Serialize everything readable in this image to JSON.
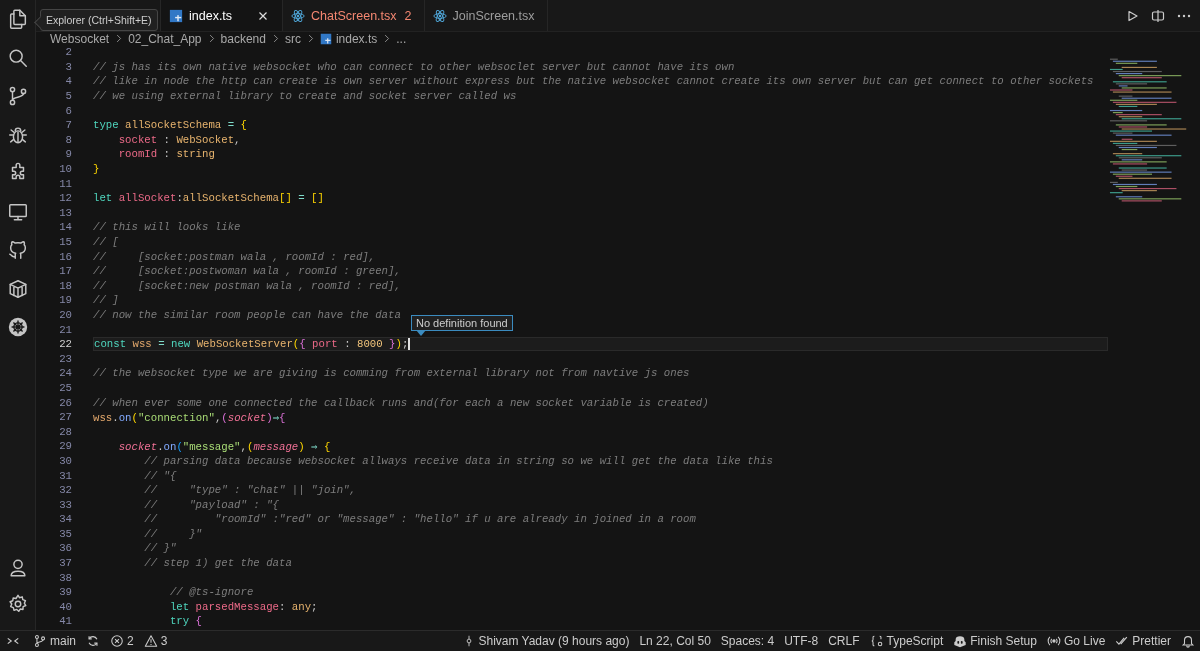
{
  "tooltip": {
    "text": "Explorer (Ctrl+Shift+E)"
  },
  "tabs": [
    {
      "label": "index.ts",
      "kind": "ts",
      "selected": true
    },
    {
      "label": "ChatScreen.tsx",
      "kind": "react",
      "selected": false,
      "problems": "2"
    },
    {
      "label": "JoinScreen.tsx",
      "kind": "react",
      "selected": false
    }
  ],
  "breadcrumbs": [
    {
      "label": "Websocket",
      "kind": "folder"
    },
    {
      "label": "02_Chat_App",
      "kind": "folder"
    },
    {
      "label": "backend",
      "kind": "folder"
    },
    {
      "label": "src",
      "kind": "folder"
    },
    {
      "label": "index.ts",
      "kind": "ts"
    },
    {
      "label": "...",
      "kind": "more"
    }
  ],
  "code": {
    "lines": [
      {
        "number": "2",
        "current": false
      },
      {
        "number": "3",
        "current": false,
        "tokens": [
          {
            "kind": "comment",
            "text": "// js has its own native websocket who can connect to other websoclet server but cannot have its own"
          }
        ]
      },
      {
        "number": "4",
        "current": false,
        "tokens": [
          {
            "kind": "comment",
            "text": "// like in node the http can create is own server without express but the native websocket cannot create its own server but can get connect to other sockets"
          }
        ]
      },
      {
        "number": "5",
        "current": false,
        "tokens": [
          {
            "kind": "comment",
            "text": "// we using external library to create and socket server called ws"
          }
        ]
      },
      {
        "number": "6",
        "current": false
      },
      {
        "number": "7",
        "current": false,
        "tokens": [
          {
            "kind": "keyword",
            "text": "type "
          },
          {
            "kind": "type",
            "text": "allSocketSchema"
          },
          {
            "kind": "operator",
            "text": " = "
          },
          {
            "kind": "bracket1",
            "text": "{"
          }
        ]
      },
      {
        "number": "8",
        "current": false,
        "tokens": [
          {
            "kind": "variable",
            "text": "    socket"
          },
          {
            "kind": "punct",
            "text": " : "
          },
          {
            "kind": "type",
            "text": "WebSocket"
          },
          {
            "kind": "punct",
            "text": ","
          }
        ]
      },
      {
        "number": "9",
        "current": false,
        "tokens": [
          {
            "kind": "variable",
            "text": "    roomId"
          },
          {
            "kind": "punct",
            "text": " : "
          },
          {
            "kind": "type",
            "text": "string"
          }
        ]
      },
      {
        "number": "10",
        "current": false,
        "tokens": [
          {
            "kind": "bracket1",
            "text": "}"
          }
        ]
      },
      {
        "number": "11",
        "current": false
      },
      {
        "number": "12",
        "current": false,
        "tokens": [
          {
            "kind": "keyword",
            "text": "let "
          },
          {
            "kind": "variable",
            "text": "allSocket"
          },
          {
            "kind": "punct",
            "text": ":"
          },
          {
            "kind": "type",
            "text": "allSocketSchema"
          },
          {
            "kind": "bracket1",
            "text": "[]"
          },
          {
            "kind": "operator",
            "text": " = "
          },
          {
            "kind": "bracket1",
            "text": "[]"
          }
        ]
      },
      {
        "number": "13",
        "current": false
      },
      {
        "number": "14",
        "current": false,
        "tokens": [
          {
            "kind": "comment",
            "text": "// this will looks like"
          }
        ]
      },
      {
        "number": "15",
        "current": false,
        "tokens": [
          {
            "kind": "comment",
            "text": "// ["
          }
        ]
      },
      {
        "number": "16",
        "current": false,
        "tokens": [
          {
            "kind": "comment",
            "text": "//     [socket:postman wala , roomId : red],"
          }
        ]
      },
      {
        "number": "17",
        "current": false,
        "tokens": [
          {
            "kind": "comment",
            "text": "//     [socket:postwoman wala , roomId : green],"
          }
        ]
      },
      {
        "number": "18",
        "current": false,
        "tokens": [
          {
            "kind": "comment",
            "text": "//     [socket:new postman wala , roomId : red],"
          }
        ]
      },
      {
        "number": "19",
        "current": false,
        "tokens": [
          {
            "kind": "comment",
            "text": "// ]"
          }
        ]
      },
      {
        "number": "20",
        "current": false,
        "tokens": [
          {
            "kind": "comment",
            "text": "// now the similar room people can have the data"
          }
        ]
      },
      {
        "number": "21",
        "current": false
      },
      {
        "number": "22",
        "current": true,
        "tokens": [
          {
            "kind": "keyword",
            "text": "const "
          },
          {
            "kind": "constant",
            "text": "wss"
          },
          {
            "kind": "operator",
            "text": " = "
          },
          {
            "kind": "keyword",
            "text": "new "
          },
          {
            "kind": "type",
            "text": "WebSocketServer"
          },
          {
            "kind": "bracket1",
            "text": "("
          },
          {
            "kind": "bracket2",
            "text": "{ "
          },
          {
            "kind": "variable",
            "text": "port"
          },
          {
            "kind": "punct",
            "text": " : "
          },
          {
            "kind": "number",
            "text": "8000"
          },
          {
            "kind": "bracket2",
            "text": " }"
          },
          {
            "kind": "bracket1",
            "text": ")"
          },
          {
            "kind": "punct",
            "text": ";"
          }
        ]
      },
      {
        "number": "23",
        "current": false
      },
      {
        "number": "24",
        "current": false,
        "tokens": [
          {
            "kind": "comment",
            "text": "// the websocket type we are giving is comming from external library not from navtive js ones"
          }
        ]
      },
      {
        "number": "25",
        "current": false
      },
      {
        "number": "26",
        "current": false,
        "tokens": [
          {
            "kind": "comment",
            "text": "// when ever some one connected the callback runs and(for each a new socket variable is created)"
          }
        ]
      },
      {
        "number": "27",
        "current": false,
        "tokens": [
          {
            "kind": "constant",
            "text": "wss"
          },
          {
            "kind": "punct",
            "text": "."
          },
          {
            "kind": "method",
            "text": "on"
          },
          {
            "kind": "bracket1",
            "text": "("
          },
          {
            "kind": "string",
            "text": "\"connection\""
          },
          {
            "kind": "punct",
            "text": ","
          },
          {
            "kind": "bracket2",
            "text": "("
          },
          {
            "kind": "param",
            "text": "socket"
          },
          {
            "kind": "bracket2",
            "text": ")"
          },
          {
            "kind": "operator",
            "text": "⇒"
          },
          {
            "kind": "bracket2",
            "text": "{"
          }
        ]
      },
      {
        "number": "28",
        "current": false
      },
      {
        "number": "29",
        "current": false,
        "tokens": [
          {
            "kind": "param",
            "text": "    socket"
          },
          {
            "kind": "punct",
            "text": "."
          },
          {
            "kind": "method",
            "text": "on"
          },
          {
            "kind": "bracket3",
            "text": "("
          },
          {
            "kind": "string",
            "text": "\"message\""
          },
          {
            "kind": "punct",
            "text": ","
          },
          {
            "kind": "bracket1",
            "text": "("
          },
          {
            "kind": "param",
            "text": "message"
          },
          {
            "kind": "bracket1",
            "text": ")"
          },
          {
            "kind": "operator",
            "text": " ⇒ "
          },
          {
            "kind": "bracket1",
            "text": "{"
          }
        ]
      },
      {
        "number": "30",
        "current": false,
        "tokens": [
          {
            "kind": "comment",
            "text": "        // parsing data because websocket allways receive data in string so we will get the data like this"
          }
        ]
      },
      {
        "number": "31",
        "current": false,
        "tokens": [
          {
            "kind": "comment",
            "text": "        // \"{"
          }
        ]
      },
      {
        "number": "32",
        "current": false,
        "tokens": [
          {
            "kind": "comment",
            "text": "        //     \"type\" : \"chat\" || \"join\","
          }
        ]
      },
      {
        "number": "33",
        "current": false,
        "tokens": [
          {
            "kind": "comment",
            "text": "        //     \"payload\" : \"{"
          }
        ]
      },
      {
        "number": "34",
        "current": false,
        "tokens": [
          {
            "kind": "comment",
            "text": "        //         \"roomId\" :\"red\" or \"message\" : \"hello\" if u are already in joined in a room"
          }
        ]
      },
      {
        "number": "35",
        "current": false,
        "tokens": [
          {
            "kind": "comment",
            "text": "        //     }\""
          }
        ]
      },
      {
        "number": "36",
        "current": false,
        "tokens": [
          {
            "kind": "comment",
            "text": "        // }\""
          }
        ]
      },
      {
        "number": "37",
        "current": false,
        "tokens": [
          {
            "kind": "comment",
            "text": "        // step 1) get the data"
          }
        ]
      },
      {
        "number": "38",
        "current": false
      },
      {
        "number": "39",
        "current": false,
        "tokens": [
          {
            "kind": "comment",
            "text": "            // @ts-ignore"
          }
        ]
      },
      {
        "number": "40",
        "current": false,
        "tokens": [
          {
            "kind": "keyword",
            "text": "            let "
          },
          {
            "kind": "variable",
            "text": "parsedMessage"
          },
          {
            "kind": "punct",
            "text": ": "
          },
          {
            "kind": "type",
            "text": "any"
          },
          {
            "kind": "punct",
            "text": ";"
          }
        ]
      },
      {
        "number": "41",
        "current": false,
        "tokens": [
          {
            "kind": "keyword",
            "text": "            try "
          },
          {
            "kind": "bracket2",
            "text": "{"
          }
        ]
      }
    ]
  },
  "hover": {
    "text": "No definition found"
  },
  "status_bar": {
    "left": [
      {
        "kind": "remote"
      },
      {
        "kind": "branch",
        "text": "main"
      },
      {
        "kind": "sync"
      },
      {
        "kind": "errors",
        "text": "2"
      },
      {
        "kind": "warnings",
        "text": "3"
      }
    ],
    "right": [
      {
        "kind": "blame",
        "text": "Shivam Yadav (9 hours ago)"
      },
      {
        "kind": "plain",
        "text": "Ln 22, Col 50"
      },
      {
        "kind": "plain",
        "text": "Spaces: 4"
      },
      {
        "kind": "plain",
        "text": "UTF-8"
      },
      {
        "kind": "plain",
        "text": "CRLF"
      },
      {
        "kind": "language",
        "text": "TypeScript"
      },
      {
        "kind": "copilot",
        "text": "Finish Setup"
      },
      {
        "kind": "live",
        "text": "Go Live"
      },
      {
        "kind": "prettier",
        "text": "Prettier"
      },
      {
        "kind": "bell"
      }
    ]
  }
}
